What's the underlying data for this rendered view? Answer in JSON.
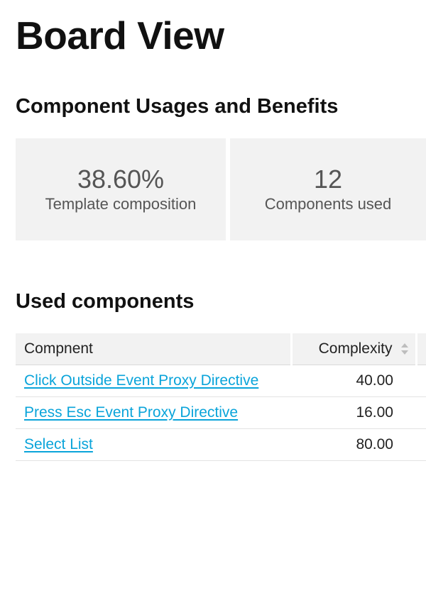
{
  "page": {
    "title": "Board View"
  },
  "benefits_section": {
    "heading": "Component Usages and Benefits",
    "stats": [
      {
        "value": "38.60%",
        "label": "Template composition"
      },
      {
        "value": "12",
        "label": "Components used"
      }
    ]
  },
  "used_section": {
    "heading": "Used components",
    "columns": {
      "component": "Compnent",
      "complexity": "Complexity"
    },
    "rows": [
      {
        "name": "Click Outside Event Proxy Directive",
        "complexity": "40.00"
      },
      {
        "name": "Press Esc Event Proxy Directive",
        "complexity": "16.00"
      },
      {
        "name": "Select List",
        "complexity": "80.00"
      }
    ]
  }
}
